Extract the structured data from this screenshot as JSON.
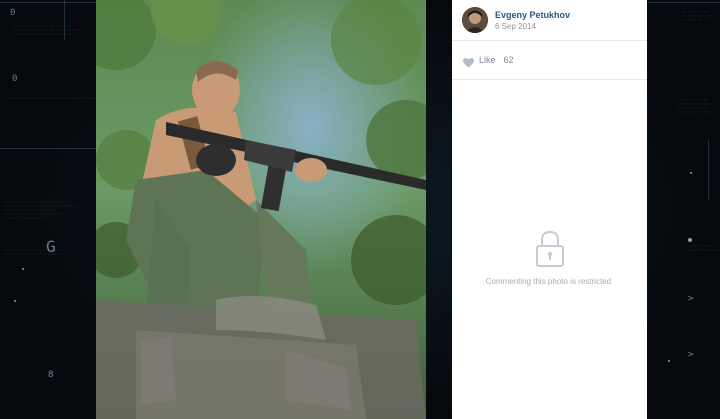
{
  "post": {
    "author_name": "Evgeny Petukhov",
    "date": "6 Sep 2014",
    "like_label": "Like",
    "like_count": "62",
    "restricted_message": "Commenting this photo is restricted."
  },
  "hud": {
    "left_glyphs": [
      "0",
      "0",
      "G",
      "8"
    ],
    "right_glyphs": [
      ">",
      ">"
    ]
  },
  "icons": {
    "heart": "heart-icon",
    "lock": "lock-icon"
  },
  "colors": {
    "author_link": "#2a5885",
    "muted_text": "#939393",
    "panel_bg": "#ffffff",
    "backdrop": "#05090d"
  }
}
